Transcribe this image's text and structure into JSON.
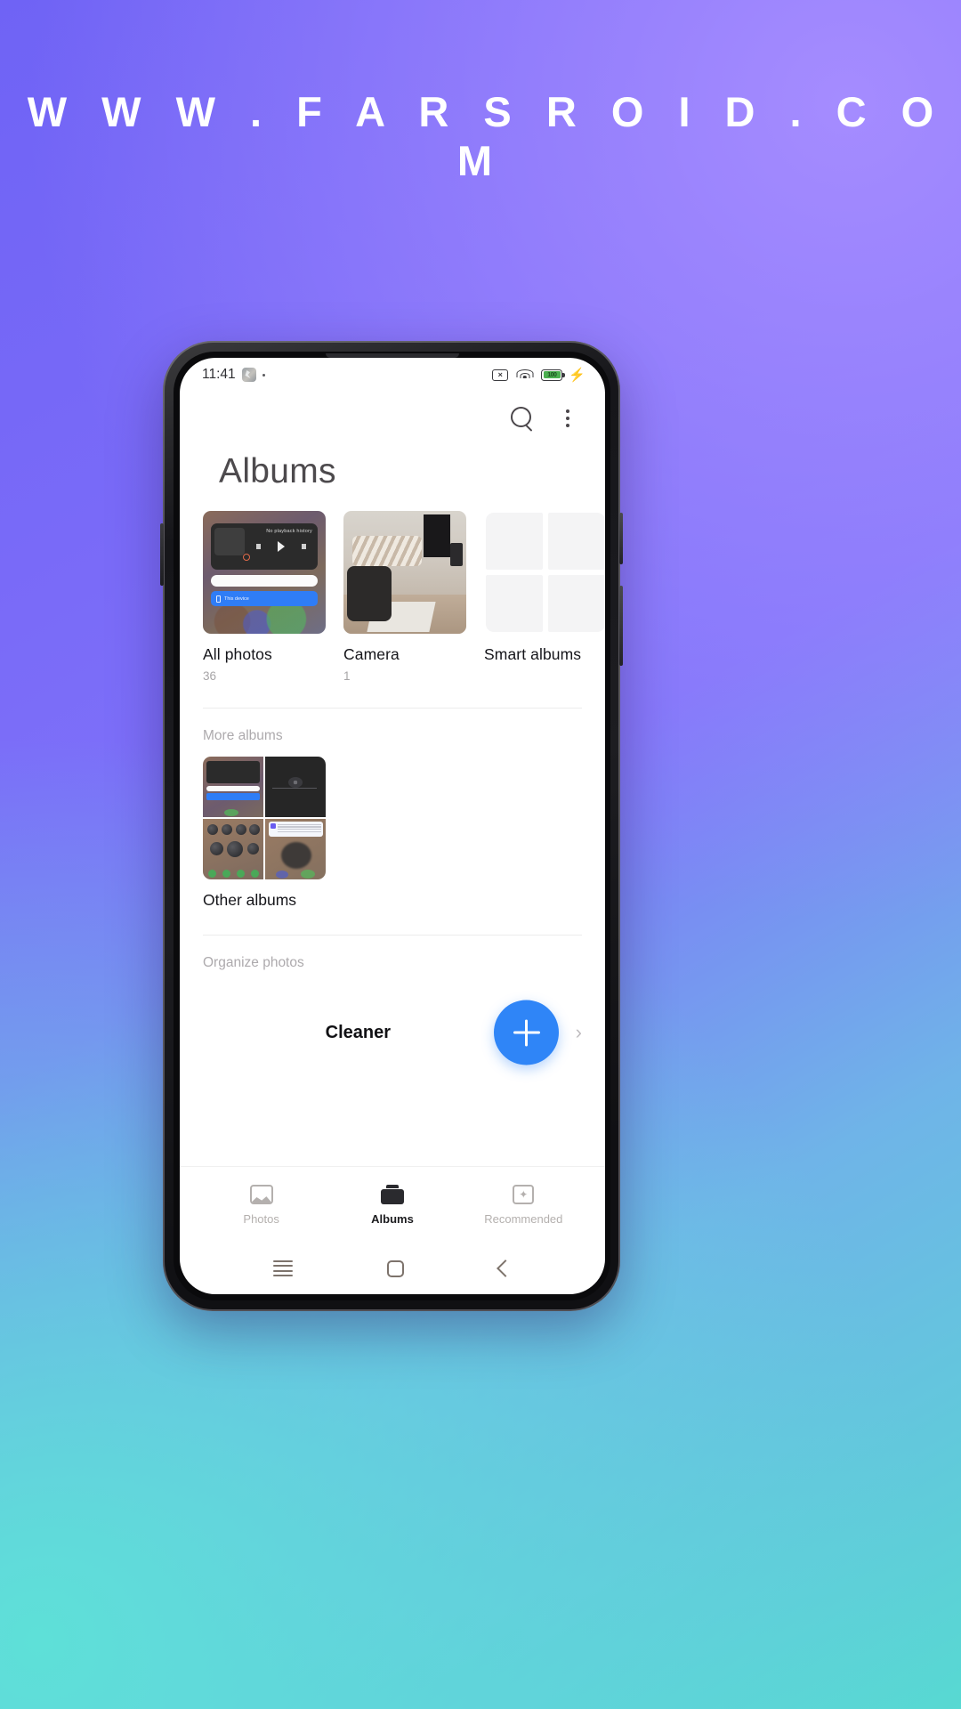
{
  "watermark": "W W W . F A R S R O I D . C O M",
  "status_bar": {
    "time": "11:41",
    "app_icon": "weather-icon",
    "dot": "·",
    "mute_icon": "×",
    "battery_text": "100",
    "charging_icon": "⚡"
  },
  "header": {
    "search_icon": "search-icon",
    "overflow_icon": "more-vertical-icon",
    "title": "Albums"
  },
  "albums": [
    {
      "name": "All photos",
      "count": "36",
      "thumb": "media-player-screenshot"
    },
    {
      "name": "Camera",
      "count": "1",
      "thumb": "room-photo"
    },
    {
      "name": "Smart albums",
      "count": "",
      "thumb": "empty-grid-placeholder"
    }
  ],
  "more_albums": {
    "section_label": "More albums",
    "item_name": "Other albums"
  },
  "organize": {
    "section_label": "Organize photos",
    "cleaner_label": "Cleaner",
    "chevron": "›",
    "fab_icon": "plus-icon"
  },
  "bottom_nav": [
    {
      "label": "Photos",
      "icon": "photos-icon",
      "active": false
    },
    {
      "label": "Albums",
      "icon": "albums-icon",
      "active": true
    },
    {
      "label": "Recommended",
      "icon": "sparkle-icon",
      "active": false
    }
  ],
  "system_nav": {
    "menu": "menu-icon",
    "home": "home-icon",
    "back": "back-icon"
  },
  "colors": {
    "accent": "#2f85f7",
    "battery": "#4caf50",
    "active_text": "#1c1c1f",
    "muted_text": "#b4b0ae"
  }
}
